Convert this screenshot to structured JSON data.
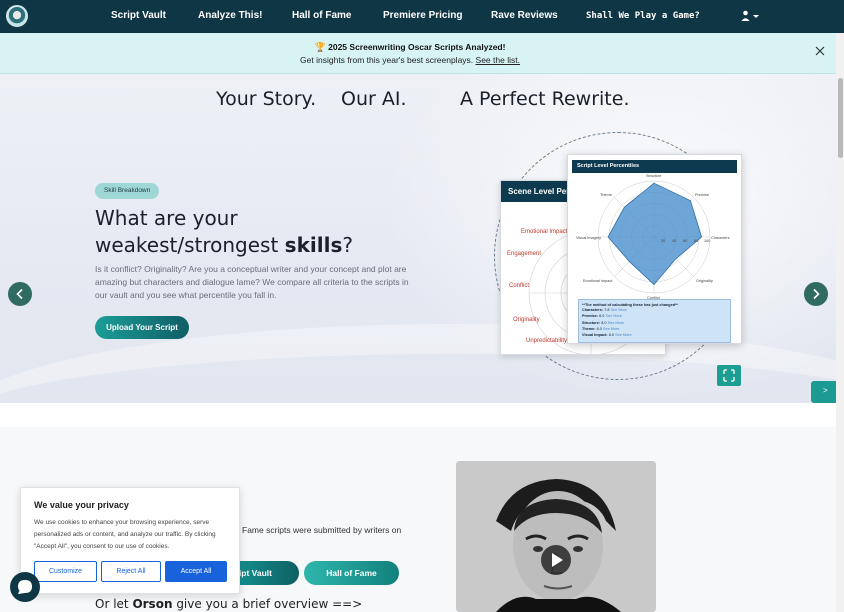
{
  "nav": {
    "links": [
      "Script Vault",
      "Analyze This!",
      "Hall of Fame",
      "Premiere Pricing",
      "Rave Reviews",
      "Shall We Play a Game?"
    ],
    "colors": {
      "background": "#0e3644",
      "text": "#ffffff"
    }
  },
  "announcement": {
    "title": "2025 Screenwriting Oscar Scripts Analyzed!",
    "subtitle": "Get insights from this year's best screenplays.",
    "link": "See the list."
  },
  "hero": {
    "tagline": [
      "Your Story.",
      "Our AI.",
      "A Perfect Rewrite."
    ],
    "badge": "Skill Breakdown",
    "heading_pre": "What are your weakest/strongest ",
    "heading_bold": "skills",
    "heading_post": "?",
    "body": "Is it conflict? Originality? Are you a conceptual writer and your concept and plot are amazing but characters and dialogue lame? We compare all criteria to the scripts in our vault and you see what percentile you fall in.",
    "button": "Upload Your Script",
    "scene_card": {
      "title": "Scene Level Per",
      "labels": [
        "Emotional Impact",
        "Engagement",
        "Conflict",
        "Originality",
        "Unpredictability"
      ]
    },
    "script_card": {
      "title": "Script Level Percentiles",
      "axes": [
        "Structure",
        "Premise",
        "Characters",
        "Originality",
        "Conflict",
        "Emotional Impact",
        "Visual Imagery",
        "Theme"
      ],
      "ticks": [
        "20",
        "40",
        "60",
        "80",
        "100"
      ],
      "note": "**The method of calculating these has just changed**",
      "rows": [
        {
          "label": "Characters:",
          "value": "7.8",
          "link": "See More"
        },
        {
          "label": "Premise:",
          "value": "8.0",
          "link": "See More"
        },
        {
          "label": "Structure:",
          "value": "8.0",
          "link": "See More"
        },
        {
          "label": "Theme:",
          "value": "8.0",
          "link": "See More"
        },
        {
          "label": "Visual Impact:",
          "value": "8.0",
          "link": "See More"
        }
      ]
    },
    "side_tab": ">"
  },
  "section2": {
    "text": "Fame scripts were submitted by writers on",
    "btn_vault": "ript Vault",
    "btn_hof": "Hall of Fame",
    "orson_pre": "Or let ",
    "orson_bold": "Orson",
    "orson_post": " give you a brief overview ==>"
  },
  "cookie": {
    "title": "We value your privacy",
    "body": "We use cookies to enhance your browsing experience, serve personalized ads or content, and analyze our traffic. By clicking \"Accept All\", you consent to our use of cookies.",
    "customize": "Customize",
    "reject": "Reject All",
    "accept": "Accept All",
    "accent": "#1863dc"
  }
}
